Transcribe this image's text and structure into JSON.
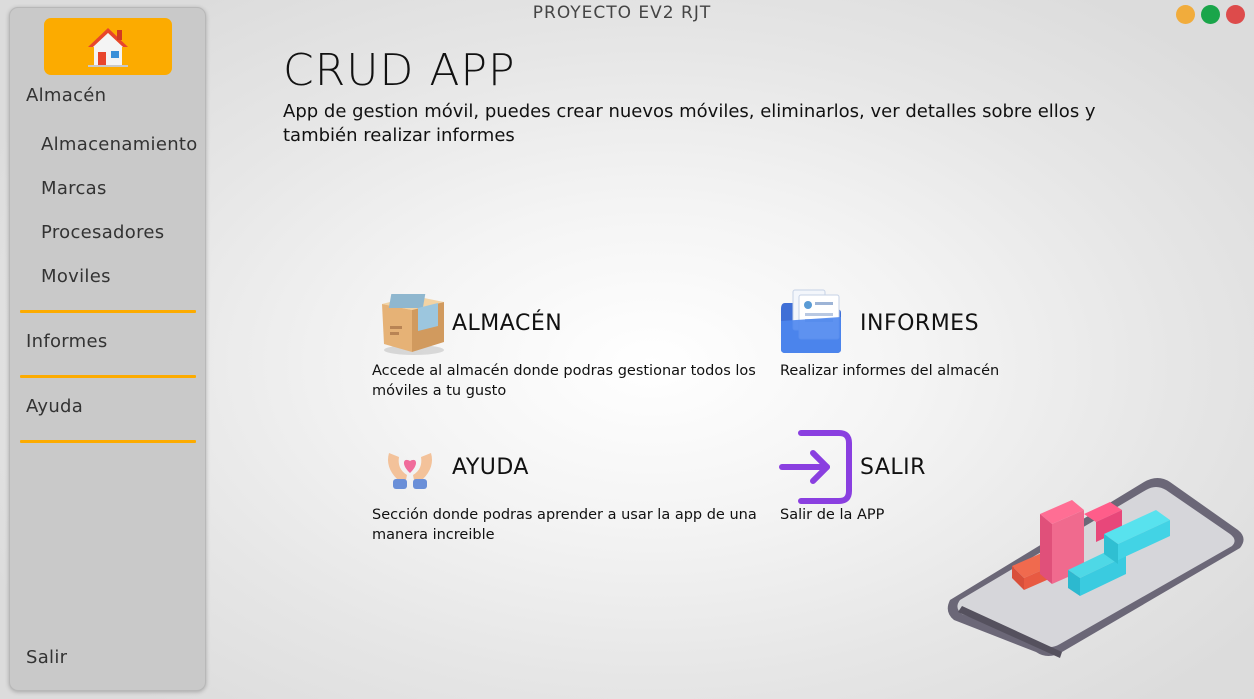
{
  "window": {
    "title": "PROYECTO EV2 RJT",
    "controls": {
      "minimize": "minimize-dot",
      "maximize": "maximize-dot",
      "close": "close-dot"
    },
    "colors": {
      "minimize": "#f1ac3c",
      "maximize": "#1aa54a",
      "close": "#dd4b4b"
    }
  },
  "sidebar": {
    "home_icon": "house-icon",
    "accent": "#fcab00",
    "almacen_label": "Almacén",
    "items": [
      {
        "label": "Almacenamiento"
      },
      {
        "label": "Marcas"
      },
      {
        "label": "Procesadores"
      },
      {
        "label": "Moviles"
      }
    ],
    "informes_label": "Informes",
    "ayuda_label": "Ayuda",
    "salir_label": "Salir"
  },
  "main": {
    "title": "CRUD APP",
    "subtitle": "App de gestion móvil, puedes crear nuevos móviles, eliminarlos, ver detalles sobre ellos y también realizar informes",
    "cards": {
      "almacen": {
        "icon": "box-icon",
        "title": "ALMACÉN",
        "desc": "Accede al almacén donde podras gestionar todos los móviles a tu gusto"
      },
      "informes": {
        "icon": "folder-icon",
        "title": "INFORMES",
        "desc": "Realizar informes del almacén"
      },
      "ayuda": {
        "icon": "heart-hands-icon",
        "title": "AYUDA",
        "desc": "Sección donde podras aprender a usar la app de una manera increible"
      },
      "salir": {
        "icon": "exit-icon",
        "title": "SALIR",
        "desc": "Salir de la APP"
      }
    }
  }
}
